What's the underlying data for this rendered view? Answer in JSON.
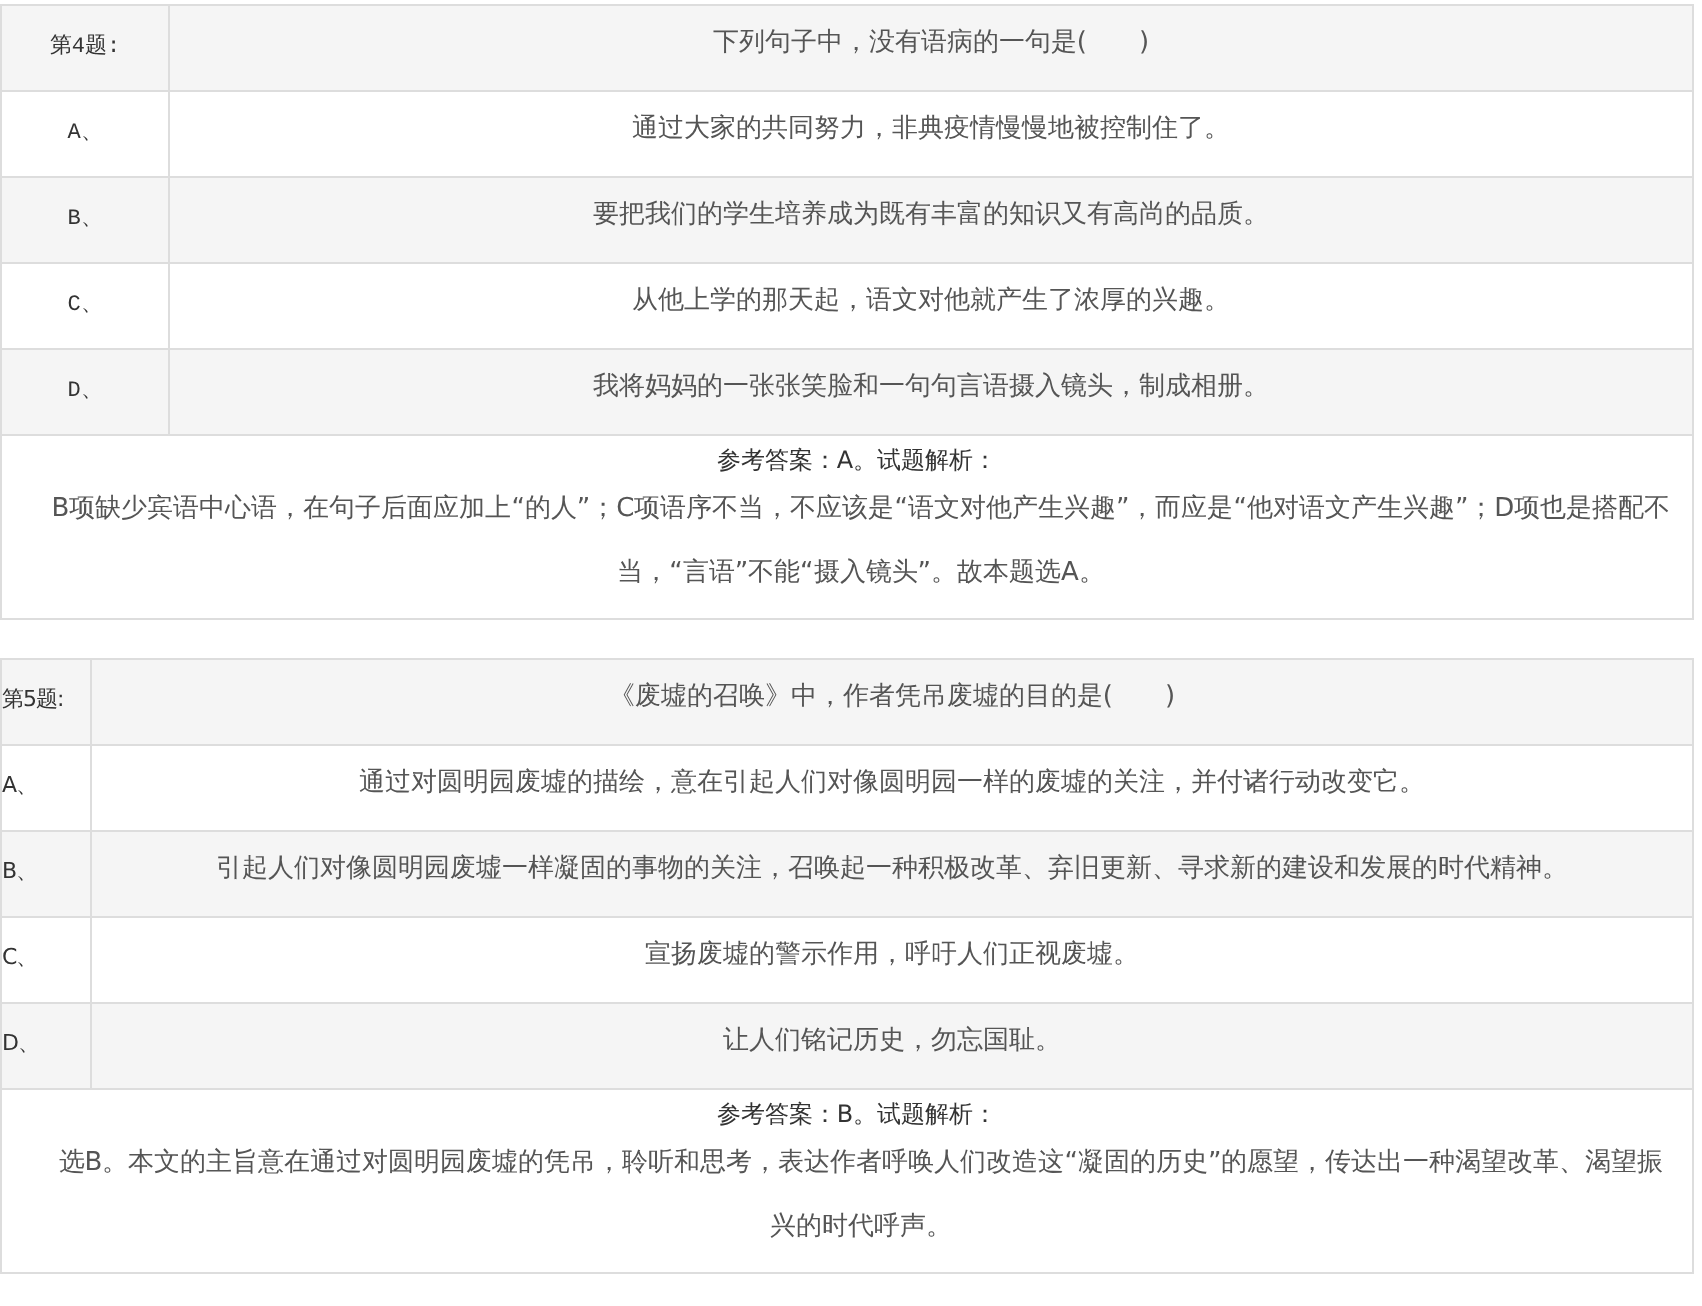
{
  "questions": [
    {
      "number": "第4题:",
      "stem": "下列句子中，没有语病的一句是(　　)",
      "options": [
        {
          "letter": "A、",
          "text": "通过大家的共同努力，非典疫情慢慢地被控制住了。"
        },
        {
          "letter": "B、",
          "text": "要把我们的学生培养成为既有丰富的知识又有高尚的品质。"
        },
        {
          "letter": "C、",
          "text": "从他上学的那天起，语文对他就产生了浓厚的兴趣。"
        },
        {
          "letter": "D、",
          "text": "我将妈妈的一张张笑脸和一句句言语摄入镜头，制成相册。"
        }
      ],
      "answer": "参考答案：A。试题解析：",
      "explanation": "B项缺少宾语中心语，在句子后面应加上“的人”；C项语序不当，不应该是“语文对他产生兴趣”，而应是“他对语文产生兴趣”；D项也是搭配不当，“言语”不能“摄入镜头”。故本题选A。"
    },
    {
      "number": "第5题:",
      "stem": "《废墟的召唤》中，作者凭吊废墟的目的是(　　)",
      "options": [
        {
          "letter": "A、",
          "text": "通过对圆明园废墟的描绘，意在引起人们对像圆明园一样的废墟的关注，并付诸行动改变它。"
        },
        {
          "letter": "B、",
          "text": "引起人们对像圆明园废墟一样凝固的事物的关注，召唤起一种积极改革、弃旧更新、寻求新的建设和发展的时代精神。"
        },
        {
          "letter": "C、",
          "text": "宣扬废墟的警示作用，呼吁人们正视废墟。"
        },
        {
          "letter": "D、",
          "text": "让人们铭记历史，勿忘国耻。"
        }
      ],
      "answer": "参考答案：B。试题解析：",
      "explanation": "选B。本文的主旨意在通过对圆明园废墟的凭吊，聆听和思考，表达作者呼唤人们改造这“凝固的历史”的愿望，传达出一种渴望改革、渴望振兴的时代呼声。"
    }
  ]
}
